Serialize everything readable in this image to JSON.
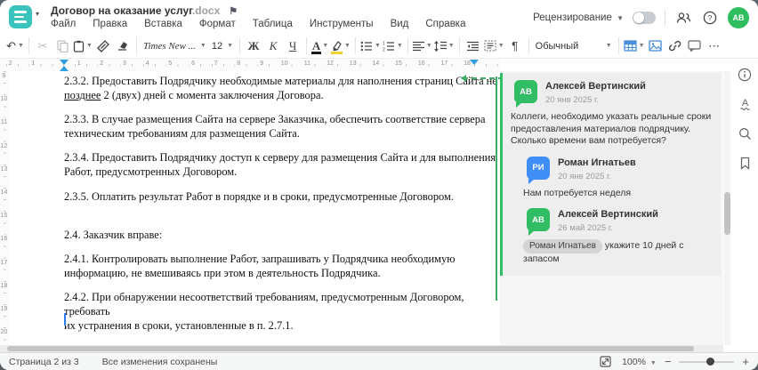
{
  "window": {
    "title": "Договор на оказание услуг",
    "title_ext": ".docx",
    "accent_teal": "#3bc4be",
    "accent_green": "#31bd63",
    "accent_blue": "#3e8ef6"
  },
  "icons": {
    "flag": "⚑",
    "undo": "↶",
    "cut": "✂",
    "paragraph_mark": "¶",
    "more": "⋯",
    "minus": "−",
    "plus": "+",
    "caret": "▾"
  },
  "menu": {
    "items": [
      "Файл",
      "Правка",
      "Вставка",
      "Формат",
      "Таблица",
      "Инструменты",
      "Вид",
      "Справка"
    ]
  },
  "header_right": {
    "review_label": "Рецензирование",
    "avatar_initials": "АВ"
  },
  "toolbar": {
    "font_name": "Times New ...",
    "font_size": "12",
    "bold": "Ж",
    "italic": "К",
    "underline": "Ч",
    "style_name": "Обычный"
  },
  "ruler": {
    "h_numbers": [
      {
        "label": "2",
        "cm": -2
      },
      {
        "label": "1",
        "cm": -1
      },
      {
        "label": "1",
        "cm": 1
      },
      {
        "label": "2",
        "cm": 2
      },
      {
        "label": "3",
        "cm": 3
      },
      {
        "label": "4",
        "cm": 4
      },
      {
        "label": "5",
        "cm": 5
      },
      {
        "label": "6",
        "cm": 6
      },
      {
        "label": "7",
        "cm": 7
      },
      {
        "label": "8",
        "cm": 8
      },
      {
        "label": "9",
        "cm": 9
      },
      {
        "label": "10",
        "cm": 10
      },
      {
        "label": "11",
        "cm": 11
      },
      {
        "label": "12",
        "cm": 12
      },
      {
        "label": "13",
        "cm": 13
      },
      {
        "label": "14",
        "cm": 14
      },
      {
        "label": "15",
        "cm": 15
      },
      {
        "label": "16",
        "cm": 16
      },
      {
        "label": "17",
        "cm": 17
      },
      {
        "label": "18",
        "cm": 18
      }
    ],
    "v_numbers": [
      "9",
      "10",
      "11",
      "12",
      "13",
      "14",
      "15",
      "16",
      "17",
      "18",
      "19",
      "20"
    ]
  },
  "document": {
    "p1_before": "2.3.2. Предоставить Подрядчику необходимые материалы для наполнения страниц Сайта не\n",
    "p1_underlined": "позднее",
    "p1_after": " 2 (двух) дней с момента заключения Договора.",
    "paragraphs": [
      "2.3.3. В случае размещения Сайта на сервере Заказчика, обеспечить соответствие сервера\nтехническим требованиям для размещения Сайта.",
      "2.3.4. Предоставить Подрядчику доступ к серверу для размещения Сайта и для выполнения\nРабот, предусмотренных Договором.",
      "2.3.5. Оплатить результат Работ в порядке и в сроки, предусмотренные Договором.",
      "2.4. Заказчик вправе:",
      "2.4.1. Контролировать выполнение Работ, запрашивать у Подрядчика необходимую\nинформацию, не вмешиваясь при этом в деятельность Подрядчика.",
      "2.4.2. При обнаружении несоответствий требованиям, предусмотренным Договором, требовать\nих устранения в сроки, установленные в п. 2.7.1."
    ]
  },
  "comments": {
    "thread": [
      {
        "initials": "АВ",
        "name": "Алексей Вертинский",
        "date": "20 янв 2025 г.",
        "text": "Коллеги, необходимо указать реальные сроки предоставления материалов подрядчику. Сколько времени вам потребуется?"
      },
      {
        "initials": "РИ",
        "name": "Роман Игнатьев",
        "date": "20 янв 2025 г.",
        "text": "Нам потребуется неделя"
      },
      {
        "initials": "АВ",
        "name": "Алексей Вертинский",
        "date": "26 май 2025 г.",
        "mention": "Роман Игнатьев",
        "text": " укажите 10 дней с запасом"
      }
    ]
  },
  "status_bar": {
    "page_info": "Страница 2 из 3",
    "saved_info": "Все изменения сохранены",
    "zoom_level": "100%"
  }
}
